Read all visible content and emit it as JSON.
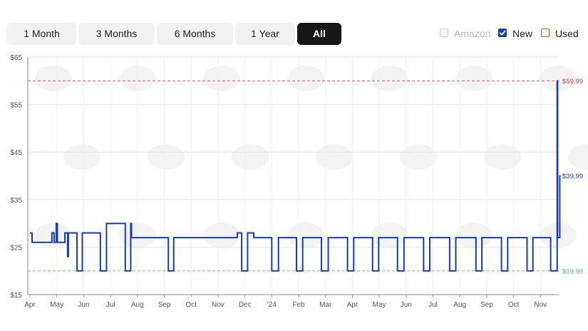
{
  "range_buttons": [
    {
      "label": "1 Month",
      "active": false
    },
    {
      "label": "3 Months",
      "active": false
    },
    {
      "label": "6 Months",
      "active": false
    },
    {
      "label": "1 Year",
      "active": false
    },
    {
      "label": "All",
      "active": true
    }
  ],
  "legend": [
    {
      "label": "Amazon",
      "checked": false,
      "color": "#cccccc",
      "text_color": "#bbbbbb"
    },
    {
      "label": "New",
      "checked": true,
      "color": "#1a3fa6",
      "text_color": "#222222"
    },
    {
      "label": "Used",
      "checked": false,
      "color": "#c0552b",
      "text_color": "#222222"
    }
  ],
  "chart_data": {
    "type": "line",
    "y_ticks": [
      "$65",
      "$55",
      "$45",
      "$35",
      "$25",
      "$15"
    ],
    "ylim": [
      15,
      65
    ],
    "x_ticks": [
      "Apr",
      "May",
      "Jun",
      "Jul",
      "Aug",
      "Sep",
      "Oct",
      "Nov",
      "Dec",
      "'24",
      "Feb",
      "Mar",
      "Apr",
      "May",
      "Jun",
      "Jul",
      "Aug",
      "Sep",
      "Oct",
      "Nov"
    ],
    "xlim": [
      0,
      19.75
    ],
    "grid": true,
    "reference_lines": [
      {
        "label": "$59.99",
        "value": 59.99,
        "color": "#cc4444",
        "style": "dashed"
      },
      {
        "label": "$19.99",
        "value": 19.99,
        "color": "#66bb66",
        "style": "dashed"
      }
    ],
    "series": [
      {
        "name": "New",
        "color": "#1a3fa6",
        "end_label": "$39.99",
        "points": [
          [
            0,
            27.99
          ],
          [
            0.08,
            27.99
          ],
          [
            0.08,
            25.99
          ],
          [
            0.82,
            25.99
          ],
          [
            0.82,
            27.99
          ],
          [
            0.9,
            27.99
          ],
          [
            0.9,
            25.99
          ],
          [
            0.98,
            25.99
          ],
          [
            0.98,
            29.99
          ],
          [
            1.02,
            29.99
          ],
          [
            1.02,
            25.99
          ],
          [
            1.3,
            25.99
          ],
          [
            1.3,
            27.99
          ],
          [
            1.4,
            27.99
          ],
          [
            1.4,
            22.99
          ],
          [
            1.43,
            22.99
          ],
          [
            1.43,
            27.99
          ],
          [
            1.75,
            27.99
          ],
          [
            1.75,
            19.99
          ],
          [
            1.95,
            19.99
          ],
          [
            1.95,
            27.99
          ],
          [
            2.62,
            27.99
          ],
          [
            2.62,
            19.99
          ],
          [
            2.85,
            19.99
          ],
          [
            2.85,
            29.99
          ],
          [
            3.55,
            29.99
          ],
          [
            3.55,
            19.99
          ],
          [
            3.75,
            19.99
          ],
          [
            3.75,
            29.99
          ],
          [
            3.78,
            29.99
          ],
          [
            3.78,
            26.99
          ],
          [
            5.15,
            26.99
          ],
          [
            5.15,
            19.99
          ],
          [
            5.35,
            19.99
          ],
          [
            5.35,
            26.99
          ],
          [
            7.72,
            26.99
          ],
          [
            7.72,
            27.99
          ],
          [
            7.88,
            27.99
          ],
          [
            7.88,
            19.99
          ],
          [
            8.1,
            19.99
          ],
          [
            8.1,
            27.99
          ],
          [
            8.33,
            27.99
          ],
          [
            8.33,
            26.99
          ],
          [
            9.0,
            26.99
          ],
          [
            9.0,
            19.99
          ],
          [
            9.25,
            19.99
          ],
          [
            9.25,
            26.99
          ],
          [
            9.92,
            26.99
          ],
          [
            9.92,
            19.99
          ],
          [
            10.15,
            19.99
          ],
          [
            10.15,
            26.99
          ],
          [
            10.85,
            26.99
          ],
          [
            10.85,
            19.99
          ],
          [
            11.1,
            19.99
          ],
          [
            11.1,
            26.99
          ],
          [
            11.82,
            26.99
          ],
          [
            11.82,
            19.99
          ],
          [
            12.05,
            19.99
          ],
          [
            12.05,
            26.99
          ],
          [
            12.75,
            26.99
          ],
          [
            12.75,
            19.99
          ],
          [
            12.98,
            19.99
          ],
          [
            12.98,
            26.99
          ],
          [
            13.68,
            26.99
          ],
          [
            13.68,
            19.99
          ],
          [
            13.92,
            19.99
          ],
          [
            13.92,
            26.99
          ],
          [
            14.65,
            26.99
          ],
          [
            14.65,
            19.99
          ],
          [
            14.88,
            19.99
          ],
          [
            14.88,
            26.99
          ],
          [
            15.62,
            26.99
          ],
          [
            15.62,
            19.99
          ],
          [
            15.85,
            19.99
          ],
          [
            15.85,
            26.99
          ],
          [
            16.6,
            26.99
          ],
          [
            16.6,
            19.99
          ],
          [
            16.82,
            19.99
          ],
          [
            16.82,
            26.99
          ],
          [
            17.55,
            26.99
          ],
          [
            17.55,
            19.99
          ],
          [
            17.78,
            19.99
          ],
          [
            17.78,
            26.99
          ],
          [
            18.5,
            26.99
          ],
          [
            18.5,
            19.99
          ],
          [
            18.72,
            19.99
          ],
          [
            18.72,
            26.99
          ],
          [
            19.38,
            26.99
          ],
          [
            19.38,
            19.99
          ],
          [
            19.62,
            19.99
          ],
          [
            19.62,
            59.99
          ],
          [
            19.64,
            59.99
          ],
          [
            19.64,
            26.99
          ],
          [
            19.72,
            26.99
          ],
          [
            19.72,
            39.99
          ],
          [
            19.75,
            39.99
          ]
        ]
      }
    ]
  }
}
